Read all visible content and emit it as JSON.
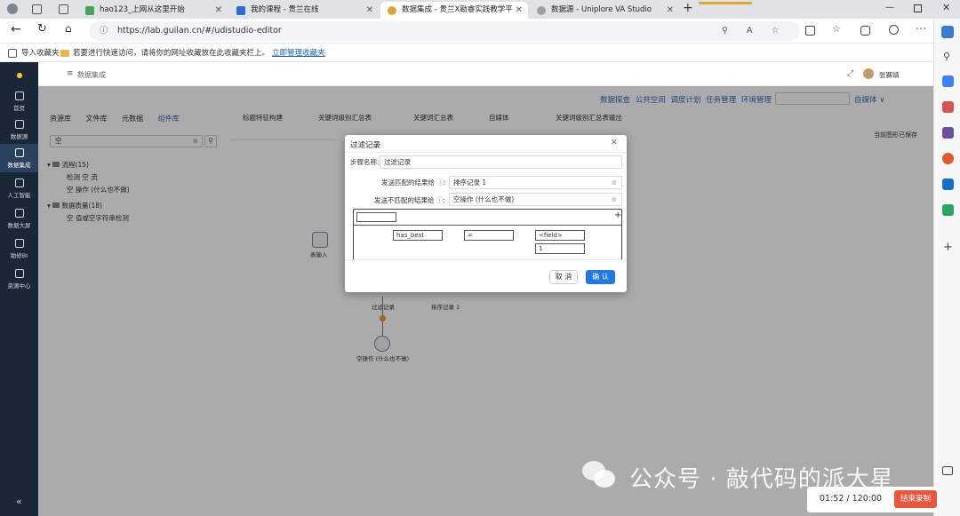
{
  "browser": {
    "tabs": [
      {
        "title": "hao123_上网从这里开始"
      },
      {
        "title": "我的课程 - 贵兰在线"
      },
      {
        "title": "数据集成 - 贵兰X勘睿实践教学平"
      },
      {
        "title": "数据源 - Uniplore VA Studio"
      }
    ],
    "url": "https://lab.guilan.cn/#/udistudio-editor",
    "favbar": {
      "import_label": "导入收藏夹",
      "hint": "若要进行快速访问，请将你的网址收藏放在此收藏夹栏上。",
      "manage_link": "立即管理收藏夹"
    }
  },
  "nav": {
    "items": [
      {
        "label": "首页"
      },
      {
        "label": "数据源"
      },
      {
        "label": "数据集成"
      },
      {
        "label": "人工智能"
      },
      {
        "label": "数据大屏"
      },
      {
        "label": "助修BI"
      },
      {
        "label": "资源中心"
      }
    ],
    "collapse": "«"
  },
  "header": {
    "breadcrumb": "数据集成",
    "user": "张赛靖",
    "menu": [
      "数据探查",
      "公共空间",
      "调度计划",
      "任务管理",
      "环境管理"
    ],
    "selfmedia": "自媒体 ∨"
  },
  "panel": {
    "tabs": [
      "资源库",
      "文件库",
      "元数据",
      "组件库"
    ],
    "search_value": "空",
    "tree": {
      "group1": "流程(15)",
      "g1_items": [
        "检测 空 流",
        "空 操作 (什么也不做)"
      ],
      "group2": "数据质量(18)",
      "g2_items": [
        "空 值或空字符串检测"
      ]
    }
  },
  "editor": {
    "tabs": [
      "标题特征构建",
      "关键词级别汇总表",
      "关键词汇总表",
      "自媒体",
      "关键词级别汇总表输出"
    ],
    "save_status": "当前图形已保存",
    "canvas_nodes": [
      "表输入",
      "过滤记录",
      "排序记录 1",
      "空操作 (什么也不做)"
    ]
  },
  "dialog": {
    "title": "过滤记录",
    "close": "✕",
    "step_name_label": "步骤名称:",
    "step_name_value": "过滤记录",
    "match_label": "发送匹配的结果给",
    "match_value": "排序记录 1",
    "nomatch_label": "发送不匹配的结果给",
    "nomatch_value": "空操作 (什么也不做)",
    "condition": {
      "field": "has_best",
      "operator": "=",
      "compare_field": "<field>",
      "value": "1"
    },
    "add": "+",
    "cancel": "取 消",
    "confirm": "确 认"
  },
  "recording": {
    "time": "01:52 / 120:00",
    "stop": "结束录制"
  },
  "watermark": "公众号 · 敲代码的派大星"
}
